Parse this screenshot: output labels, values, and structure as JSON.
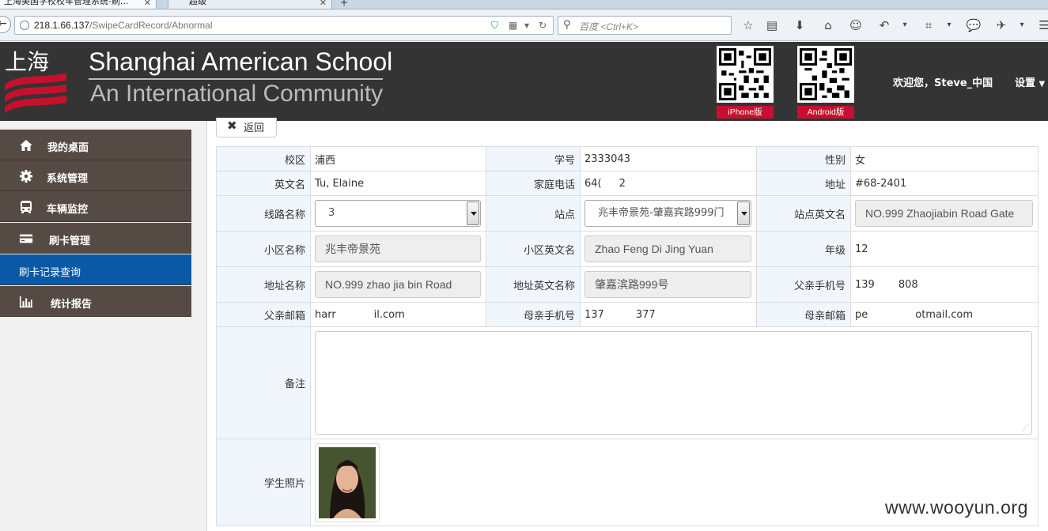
{
  "browser": {
    "tabs": [
      {
        "label": "上海美国学校校车管理系统-刷..."
      },
      {
        "label": "超级"
      }
    ],
    "url_host": "218.1.66.137",
    "url_path": "/SwipeCardRecord/Abnormal",
    "search_placeholder": "百度 <Ctrl+K>"
  },
  "header": {
    "logo_cn": "上海",
    "school_name": "Shanghai American School",
    "school_subtitle": "An International Community",
    "qr_iphone_label": "iPhone版",
    "qr_android_label": "Android版",
    "welcome": "欢迎您，Steve_中国",
    "settings": "设置"
  },
  "sidebar": {
    "items": [
      {
        "label": "我的桌面",
        "icon": "home-icon"
      },
      {
        "label": "系统管理",
        "icon": "gear-icon"
      },
      {
        "label": "车辆监控",
        "icon": "bus-icon"
      },
      {
        "label": "刷卡管理",
        "icon": "card-icon"
      },
      {
        "label": "刷卡记录查询",
        "icon": ""
      },
      {
        "label": "统计报告",
        "icon": "bar-chart-icon"
      }
    ],
    "active_index": 4,
    "colors": {
      "item_bg": "#564b44",
      "active_bg": "#0a59a6"
    }
  },
  "content": {
    "back_label": "返回",
    "fields": {
      "campus_label": "校区",
      "campus_value": "浦西",
      "student_no_label": "学号",
      "student_no_value": "2333043",
      "gender_label": "性别",
      "gender_value": "女",
      "english_name_label": "英文名",
      "english_name_value": "Tu, Elaine",
      "home_phone_label": "家庭电话",
      "home_phone_value_a": "64(",
      "home_phone_value_b": "2",
      "address_label": "地址",
      "address_value": "#68-2401",
      "route_label": "线路名称",
      "route_value": "3",
      "stop_label": "站点",
      "stop_value": "兆丰帝景苑-肇嘉宾路999门",
      "stop_en_label": "站点英文名",
      "stop_en_value": "NO.999  Zhaojiabin Road Gate",
      "community_label": "小区名称",
      "community_value": "兆丰帝景苑",
      "community_en_label": "小区英文名",
      "community_en_value": "Zhao Feng Di Jing Yuan",
      "grade_label": "年级",
      "grade_value": "12",
      "addr_name_label": "地址名称",
      "addr_name_value": "NO.999 zhao jia bin Road",
      "addr_en_label": "地址英文名称",
      "addr_en_value": "肇嘉滨路999号",
      "father_phone_label": "父亲手机号",
      "father_phone_value_a": "139",
      "father_phone_value_b": "808",
      "father_email_label": "父亲邮箱",
      "father_email_value_a": "harr",
      "father_email_value_b": "il.com",
      "mother_phone_label": "母亲手机号",
      "mother_phone_value_a": "137",
      "mother_phone_value_b": "377",
      "mother_email_label": "母亲邮箱",
      "mother_email_value_a": "pe",
      "mother_email_value_b": "otmail.com",
      "remark_label": "备注",
      "photo_label": "学生照片"
    }
  },
  "watermark": "www.wooyun.org"
}
